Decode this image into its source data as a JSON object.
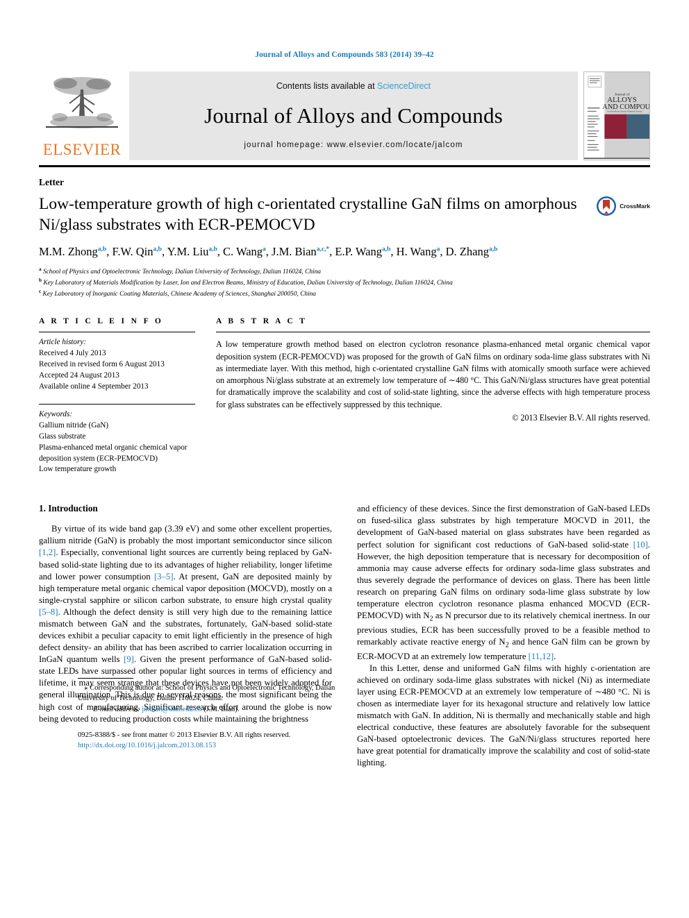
{
  "running_head": "Journal of Alloys and Compounds 583 (2014) 39–42",
  "masthead": {
    "publisher_name": "ELSEVIER",
    "contents_prefix": "Contents lists available at ",
    "sciencedirect": "ScienceDirect",
    "journal_name": "Journal of Alloys and Compounds",
    "homepage": "journal homepage: www.elsevier.com/locate/jalcom",
    "cover": {
      "line1": "Journal of",
      "line2": "ALLOYS",
      "line3": "AND COMPOUNDS",
      "subtitle": "An International Journal of Materials Science and Solid-state Chemistry and Physics",
      "color_red": "#8e2038",
      "color_blue": "#3f6179"
    },
    "link_color": "#2f9fd0"
  },
  "article": {
    "doc_type": "Letter",
    "title": "Low-temperature growth of high c-orientated crystalline GaN films on amorphous Ni/glass substrates with ECR-PEMOCVD",
    "crossmark_label": "CrossMark",
    "authors": [
      {
        "name": "M.M. Zhong",
        "sup": "a,b"
      },
      {
        "name": "F.W. Qin",
        "sup": "a,b"
      },
      {
        "name": "Y.M. Liu",
        "sup": "a,b"
      },
      {
        "name": "C. Wang",
        "sup": "a"
      },
      {
        "name": "J.M. Bian",
        "sup": "a,c,*"
      },
      {
        "name": "E.P. Wang",
        "sup": "a,b"
      },
      {
        "name": "H. Wang",
        "sup": "a"
      },
      {
        "name": "D. Zhang",
        "sup": "a,b"
      }
    ],
    "affiliations": [
      {
        "mark": "a",
        "text": "School of Physics and Optoelectronic Technology, Dalian University of Technology, Dalian 116024, China"
      },
      {
        "mark": "b",
        "text": "Key Laboratory of Materials Modification by Laser, Ion and Electron Beams, Ministry of Education, Dalian University of Technology, Dalian 116024, China"
      },
      {
        "mark": "c",
        "text": "Key Laboratory of Inorganic Coating Materials, Chinese Academy of Sciences, Shanghai 200050, China"
      }
    ]
  },
  "article_info": {
    "heading": "A R T I C L E    I N F O",
    "history_label": "Article history:",
    "history": [
      "Received 4 July 2013",
      "Received in revised form 6 August 2013",
      "Accepted 24 August 2013",
      "Available online 4 September 2013"
    ],
    "keywords_label": "Keywords:",
    "keywords": [
      "Gallium nitride (GaN)",
      "Glass substrate",
      "Plasma-enhanced metal organic chemical vapor deposition system (ECR-PEMOCVD)",
      "Low temperature growth"
    ]
  },
  "abstract": {
    "heading": "A B S T R A C T",
    "text": "A low temperature growth method based on electron cyclotron resonance plasma-enhanced metal organic chemical vapor deposition system (ECR-PEMOCVD) was proposed for the growth of GaN films on ordinary soda-lime glass substrates with Ni as intermediate layer. With this method, high c-orientated crystalline GaN films with atomically smooth surface were achieved on amorphous Ni/glass substrate at an extremely low temperature of ∼480 °C. This GaN/Ni/glass structures have great potential for dramatically improve the scalability and cost of solid-state lighting, since the adverse effects with high temperature process for glass substrates can be effectively suppressed by this technique.",
    "copyright": "© 2013 Elsevier B.V. All rights reserved."
  },
  "introduction": {
    "section_number_title": "1. Introduction",
    "para1_a": "By virtue of its wide band gap (3.39 eV) and some other excellent properties, gallium nitride (GaN) is probably the most important semiconductor since silicon ",
    "ref1": "[1,2]",
    "para1_b": ". Especially, conventional light sources are currently being replaced by GaN-based solid-state lighting due to its advantages of higher reliability, longer lifetime and lower power consumption ",
    "ref2": "[3–5]",
    "para1_c": ". At present, GaN are deposited mainly by high temperature metal organic chemical vapor deposition (MOCVD), mostly on a single-crystal sapphire or silicon carbon substrate, to ensure high crystal quality ",
    "ref3": "[5–8]",
    "para1_d": ". Although the defect density is still very high due to the remaining lattice mismatch between GaN and the substrates, fortunately, GaN-based solid-state devices exhibit a peculiar capacity to emit light efficiently in the presence of high defect density- an ability that has been ascribed to carrier localization occurring in InGaN quantum wells ",
    "ref4": "[9]",
    "para1_e": ". Given the present performance of GaN-based solid-state LEDs have surpassed other popular light sources in terms of efficiency and lifetime, it may seem strange that these devices have not been widely adopted for general illumination. This is due to several reasons, the most significant being the high cost of manufacturing. Significant research effort around the globe is now being devoted to reducing production costs while maintaining the brightness",
    "para2_a": "and efficiency of these devices. Since the first demonstration of GaN-based LEDs on fused-silica glass substrates by high temperature MOCVD in 2011, the development of GaN-based material on glass substrates have been regarded as perfect solution for significant cost reductions of GaN-based solid-state ",
    "ref5": "[10]",
    "para2_b": ". However, the high deposition temperature that is necessary for decomposition of ammonia may cause adverse effects for ordinary soda-lime glass substrates and thus severely degrade the performance of devices on glass. There has been little research on preparing GaN films on ordinary soda-lime glass substrate by low temperature electron cyclotron resonance plasma enhanced MOCVD (ECR-PEMOCVD) with N",
    "sub1": "2",
    "para2_c": " as N precursor due to its relatively chemical inertness. In our previous studies, ECR has been successfully proved to be a feasible method to remarkably activate reactive energy of N",
    "sub2": "2",
    "para2_d": " and hence GaN film can be grown by ECR-MOCVD at an extremely low temperature ",
    "ref6": "[11,12]",
    "para2_e": ".",
    "para3": "In this Letter, dense and uniformed GaN films with highly c-orientation are achieved on ordinary soda-lime glass substrates with nickel (Ni) as intermediate layer using ECR-PEMOCVD at an extremely low temperature of ∼480 °C. Ni is chosen as intermediate layer for its hexagonal structure and relatively low lattice mismatch with GaN. In addition, Ni is thermally and mechanically stable and high electrical conductive, these features are absolutely favorable for the subsequent GaN-based optoelectronic devices. The GaN/Ni/glass structures reported here have great potential for dramatically improve the scalability and cost of solid-state lighting."
  },
  "footnote": {
    "star": "⁎",
    "text": "Corresponding author at: School of Physics and Optoelectronic Technology, Dalian University of Technology, Dalian 116024, China.",
    "email_label": "E-mail address:",
    "email": "jmbian@dlut.edu.cn",
    "email_owner": "(J.M. Bian)."
  },
  "footer": {
    "issn_line": "0925-8388/$ - see front matter © 2013 Elsevier B.V. All rights reserved.",
    "doi": "http://dx.doi.org/10.1016/j.jalcom.2013.08.153"
  }
}
